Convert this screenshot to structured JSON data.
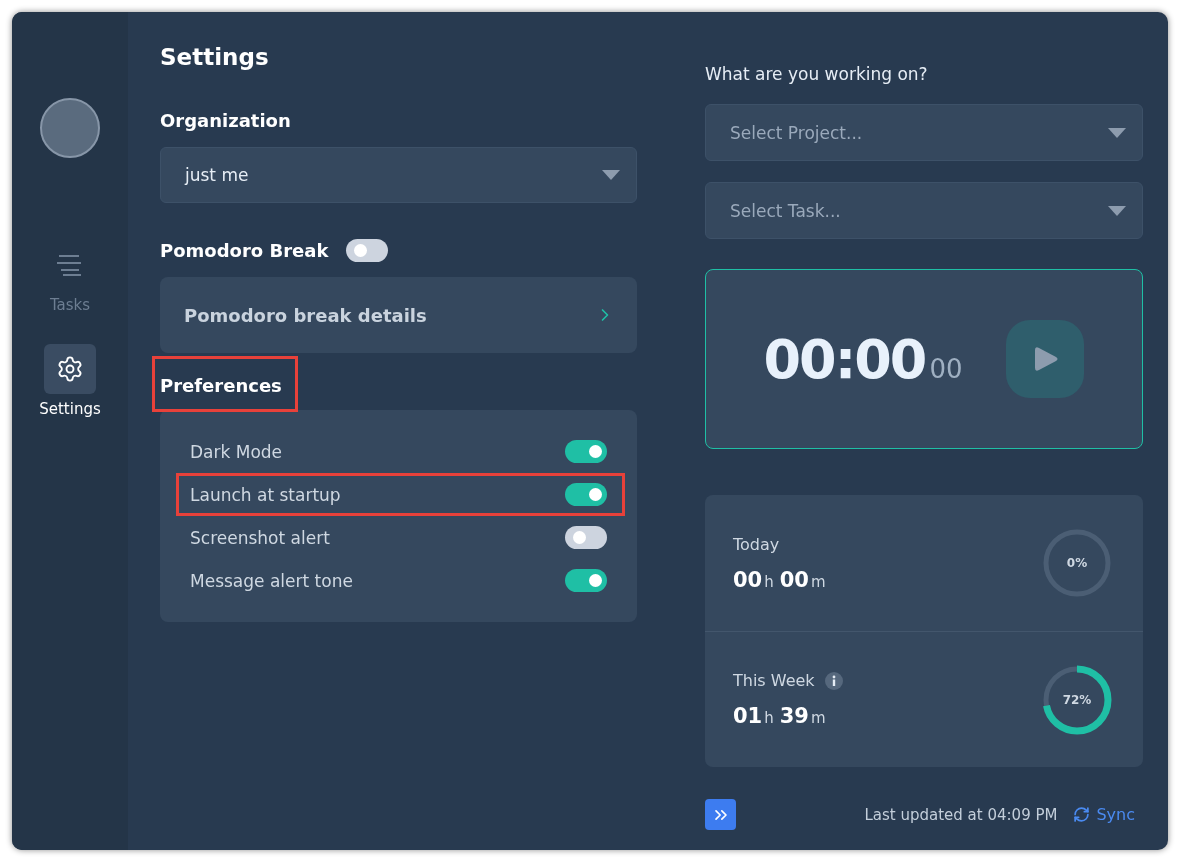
{
  "sidebar": {
    "items": [
      {
        "label": "Tasks",
        "selected": false
      },
      {
        "label": "Settings",
        "selected": true
      }
    ]
  },
  "settings": {
    "title": "Settings",
    "organization": {
      "label": "Organization",
      "value": "just me"
    },
    "pomodoro": {
      "label": "Pomodoro Break",
      "on": false,
      "details": "Pomodoro break details"
    },
    "preferences": {
      "heading": "Preferences",
      "highlighted": true,
      "items": [
        {
          "label": "Dark Mode",
          "on": true,
          "highlighted": false
        },
        {
          "label": "Launch at startup",
          "on": true,
          "highlighted": true
        },
        {
          "label": "Screenshot alert",
          "on": false,
          "highlighted": false
        },
        {
          "label": "Message alert tone",
          "on": true,
          "highlighted": false
        }
      ]
    }
  },
  "tracker": {
    "prompt": "What are you working on?",
    "selects": [
      {
        "placeholder": "Select Project..."
      },
      {
        "placeholder": "Select Task..."
      }
    ],
    "timer": {
      "main": "00:00",
      "fraction": "00"
    },
    "stats": [
      {
        "label": "Today",
        "info": false,
        "hours": "00",
        "hours_unit": "h",
        "minutes": "00",
        "minutes_unit": "m",
        "level": 0,
        "percent": "0%"
      },
      {
        "label": "This Week",
        "info": true,
        "hours": "01",
        "hours_unit": "h",
        "minutes": "39",
        "minutes_unit": "m",
        "level": 0.72,
        "percent": "72%"
      }
    ]
  },
  "footer": {
    "last_updated": "Last updated at 04:09 PM",
    "sync": "Sync"
  }
}
